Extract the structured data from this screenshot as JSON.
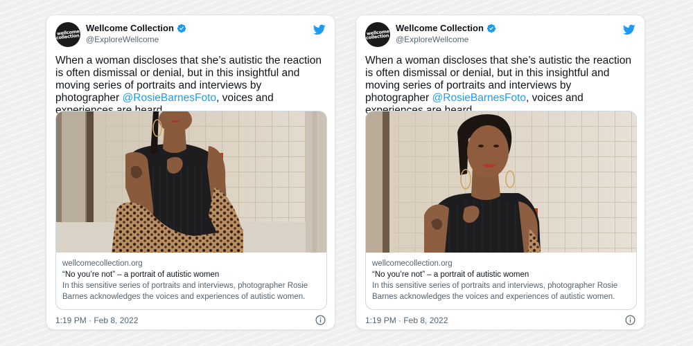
{
  "tweets": [
    {
      "author": {
        "display_name": "Wellcome Collection",
        "handle": "@ExploreWellcome",
        "avatar_text_line1": "wellcome",
        "avatar_text_line2": "collection"
      },
      "text_before_mention": "When a woman discloses that she’s autistic the reaction is often dismissal or denial, but in this insightful and moving series of portraits and interviews by photographer ",
      "mention": "@RosieBarnesFoto",
      "text_after_mention": ", voices and experiences are heard.",
      "link_card": {
        "domain": "wellcomecollection.org",
        "title": "“No you’re not” – a portrait of autistic women",
        "description": "In this sensitive series of portraits and interviews, photographer Rosie Barnes acknowledges the voices and experiences of autistic women."
      },
      "timestamp": "1:19 PM · Feb 8, 2022"
    },
    {
      "author": {
        "display_name": "Wellcome Collection",
        "handle": "@ExploreWellcome",
        "avatar_text_line1": "wellcome",
        "avatar_text_line2": "collection"
      },
      "text_before_mention": "When a woman discloses that she’s autistic the reaction is often dismissal or denial, but in this insightful and moving series of portraits and interviews by photographer ",
      "mention": "@RosieBarnesFoto",
      "text_after_mention": ", voices and experiences are heard.",
      "link_card": {
        "domain": "wellcomecollection.org",
        "title": "“No you’re not” – a portrait of autistic women",
        "description": "In this sensitive series of portraits and interviews, photographer Rosie Barnes acknowledges the voices and experiences of autistic women."
      },
      "timestamp": "1:19 PM · Feb 8, 2022"
    }
  ],
  "icons": {
    "verified": "verified-badge-icon",
    "bird": "twitter-bird-icon",
    "info": "info-icon"
  },
  "colors": {
    "twitter_blue": "#1d9bf0",
    "text_primary": "#0f1419",
    "text_secondary": "#536471"
  }
}
